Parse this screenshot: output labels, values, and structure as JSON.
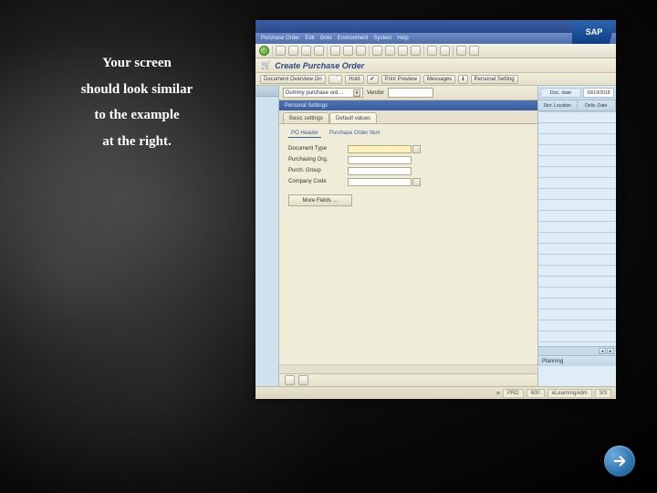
{
  "caption": {
    "line1": "Your screen",
    "line2": "should look similar",
    "line3": "to the example",
    "line4": "at the right."
  },
  "sap": {
    "brand": "SAP",
    "menu": [
      "Purchase Order",
      "Edit",
      "Goto",
      "Environment",
      "System",
      "Help"
    ],
    "heading": "Create Purchase Order",
    "subtoolbar": {
      "overview": "Document Overview On",
      "hold": "Hold",
      "preview": "Print Preview",
      "messages": "Messages",
      "personal": "Personal Setting"
    },
    "maintop": {
      "combo": "Dummy purchase ord…",
      "vendor_label": "Vendor",
      "docdate_label": "Doc. date",
      "docdate_value": "09/19/2018"
    },
    "bluestrip": "Personal Settings",
    "tabs": {
      "basic": "Basic settings",
      "defaults": "Default values"
    },
    "subtabs": {
      "header": "PO Header",
      "item": "Purchase Order Item"
    },
    "form": {
      "doc_type": "Document Type",
      "purch_org": "Purchasing Org.",
      "purch_grp": "Purch. Group",
      "comp_code": "Company Code"
    },
    "more_fields": "More Fields …",
    "right": {
      "col1": "Stor. Location",
      "col2": "Deliv. Date",
      "planning": "Planning"
    },
    "status": {
      "sys": "PRD",
      "client": "600",
      "user": "eLearningAdm",
      "session": "3/3"
    }
  }
}
